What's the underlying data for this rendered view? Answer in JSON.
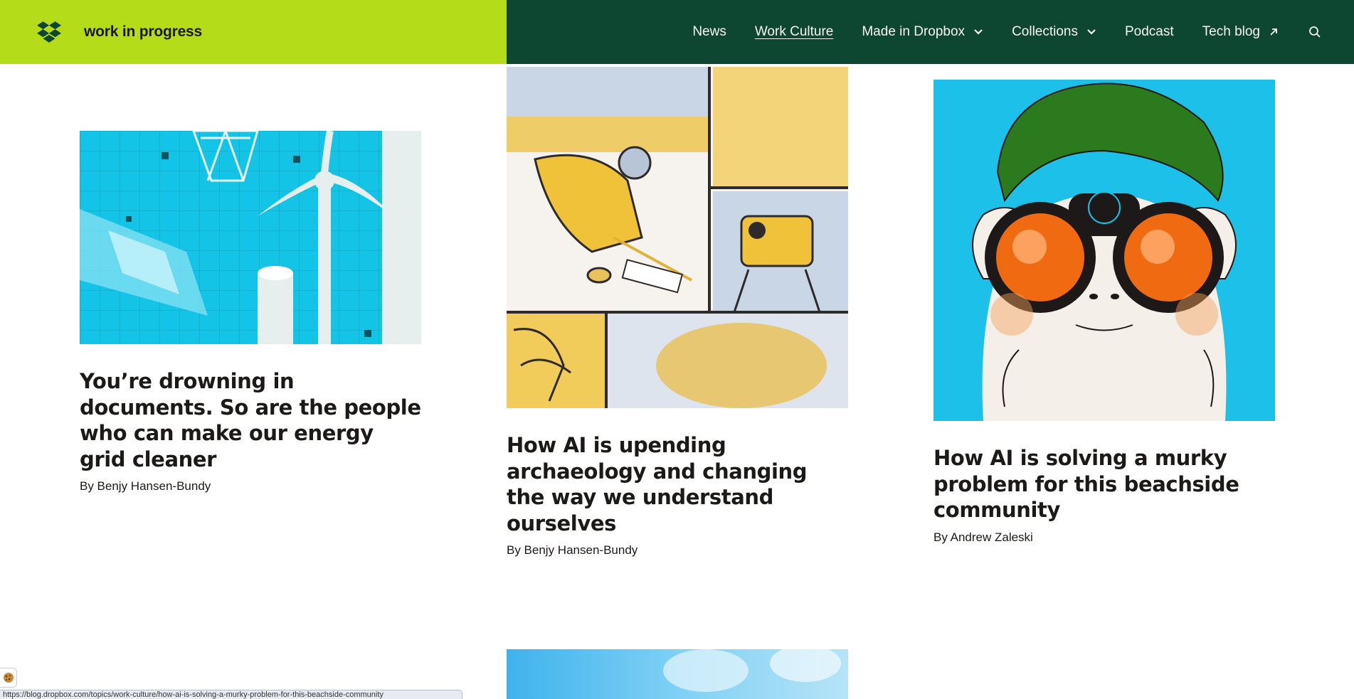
{
  "brand": {
    "wordmark": "work in progress",
    "logo_icon": "dropbox-logo-icon"
  },
  "nav": {
    "items": [
      {
        "label": "News",
        "active": false
      },
      {
        "label": "Work Culture",
        "active": true
      },
      {
        "label": "Made in Dropbox",
        "icon": "chevron-down-icon"
      },
      {
        "label": "Collections",
        "icon": "chevron-down-icon"
      },
      {
        "label": "Podcast"
      },
      {
        "label": "Tech blog",
        "icon": "external-arrow-icon"
      }
    ],
    "search_icon": "search-icon"
  },
  "articles": [
    {
      "title": "You’re drowning in documents. So are the people who can make our energy grid cleaner",
      "byline": "By Benjy Hansen-Bundy"
    },
    {
      "title": "How AI is upending archaeology and changing the way we understand ourselves",
      "byline": "By Benjy Hansen-Bundy"
    },
    {
      "title": "How AI is solving a murky problem for this beachside community",
      "byline": "By Andrew Zaleski"
    }
  ],
  "status_bar": {
    "url": "https://blog.dropbox.com/topics/work-culture/how-ai-is-solving-a-murky-problem-for-this-beachside-community"
  },
  "cookie_icon": "cookie-icon",
  "colors": {
    "brand_green": "#b4dc19",
    "nav_green": "#0d4731",
    "text": "#1e1919"
  }
}
